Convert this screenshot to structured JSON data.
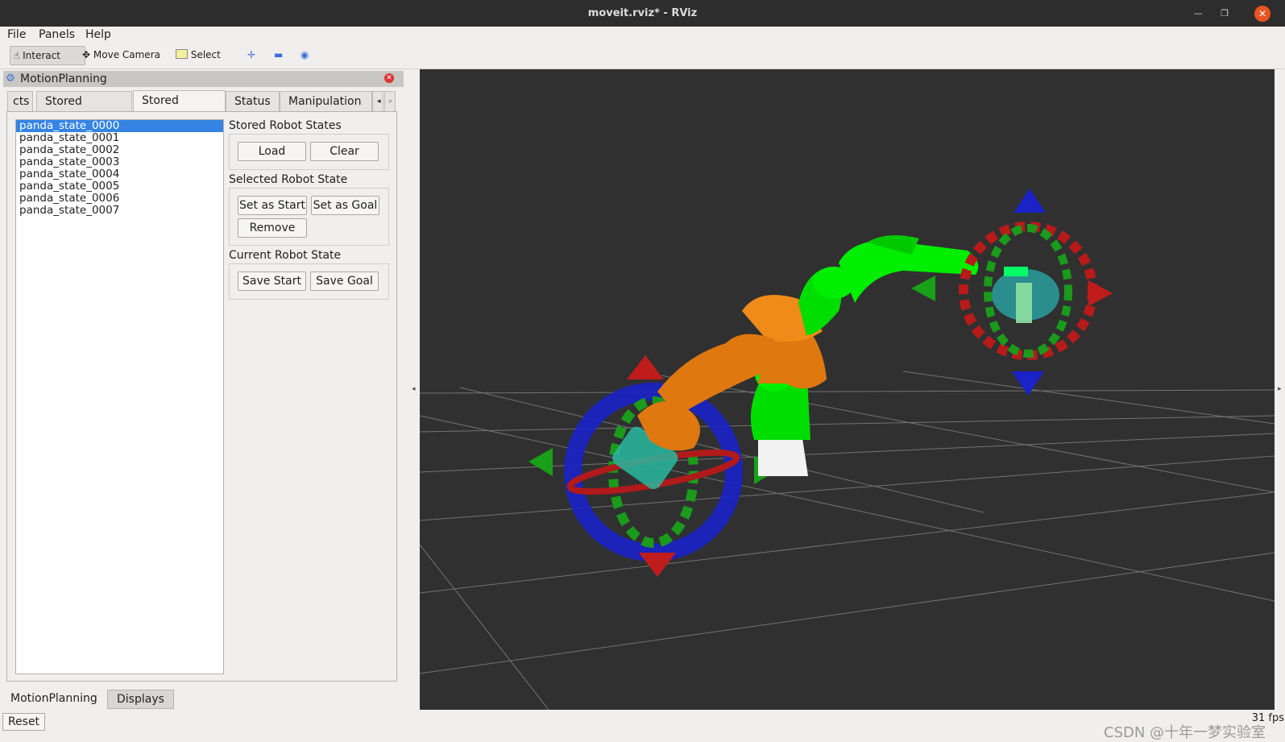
{
  "window": {
    "title": "moveit.rviz* - RViz"
  },
  "menu": {
    "file": "File",
    "panels": "Panels",
    "help": "Help"
  },
  "toolbar": {
    "interact": "Interact",
    "move_camera": "Move Camera",
    "select": "Select"
  },
  "panel": {
    "title": "MotionPlanning",
    "tabs": [
      "cts",
      "Stored Scenes",
      "Stored States",
      "Status",
      "Manipulation"
    ],
    "states": [
      "panda_state_0000",
      "panda_state_0001",
      "panda_state_0002",
      "panda_state_0003",
      "panda_state_0004",
      "panda_state_0005",
      "panda_state_0006",
      "panda_state_0007"
    ],
    "stored_robot_states": {
      "label": "Stored Robot States",
      "load": "Load",
      "clear": "Clear"
    },
    "selected_robot_state": {
      "label": "Selected Robot State",
      "set_start": "Set as Start",
      "set_goal": "Set as Goal",
      "remove": "Remove"
    },
    "current_robot_state": {
      "label": "Current Robot State",
      "save_start": "Save Start",
      "save_goal": "Save Goal"
    }
  },
  "bottom_tabs": {
    "motion_planning": "MotionPlanning",
    "displays": "Displays"
  },
  "reset": "Reset",
  "fps": "31 fps",
  "watermark": "CSDN @十年一梦实验室",
  "colors": {
    "viewport": "#303030",
    "selection": "#3584e4",
    "close": "#e95420",
    "robot_green": "#00e000",
    "robot_orange": "#e07a10"
  }
}
